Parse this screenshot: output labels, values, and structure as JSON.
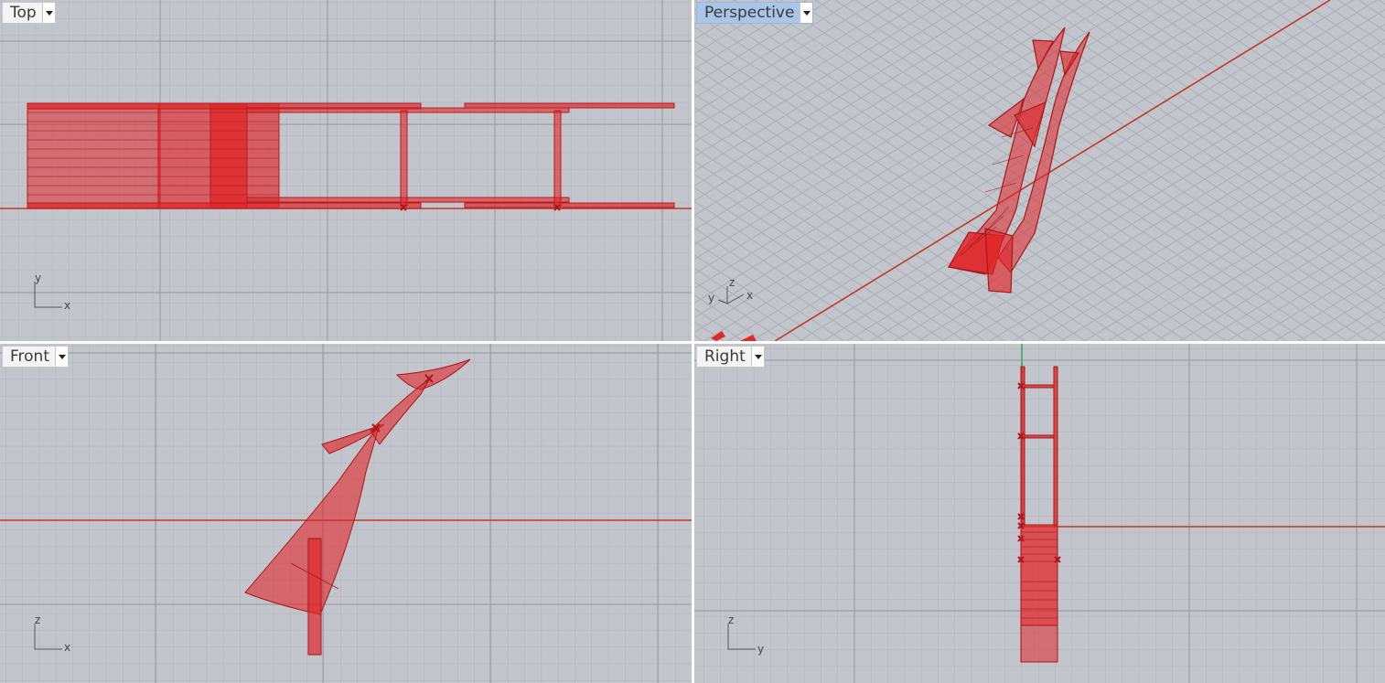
{
  "viewports": {
    "top": {
      "title": "Top",
      "axis_a": "y",
      "axis_b": "x"
    },
    "perspective": {
      "title": "Perspective",
      "axis_a": "z",
      "axis_b": "y",
      "axis_c": "x"
    },
    "front": {
      "title": "Front",
      "axis_a": "z",
      "axis_b": "x"
    },
    "right": {
      "title": "Right",
      "axis_a": "z",
      "axis_b": "y"
    }
  },
  "colors": {
    "background": "#c2c6cc",
    "grid_minor": "#b0b4ba",
    "grid_major": "#9ea3aa",
    "axis_x": "#c0392b",
    "axis_y": "#2ea44f",
    "object_fill": "#e0272b",
    "object_edge": "#b51c1c",
    "active_tab": "#a9c5e8"
  },
  "icons": [
    "dropdown-arrow-icon",
    "axis-triad-icon"
  ]
}
